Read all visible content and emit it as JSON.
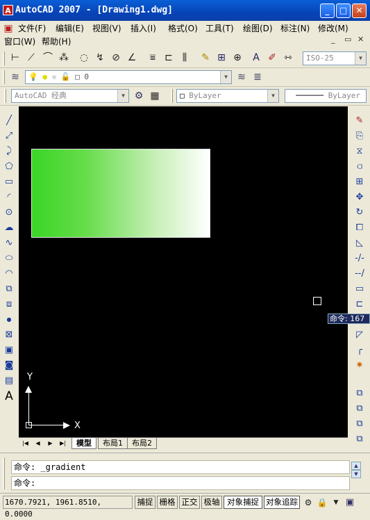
{
  "window": {
    "title": "AutoCAD 2007 - [Drawing1.dwg]",
    "app_icon_glyph": "A",
    "minimize_glyph": "_",
    "maximize_glyph": "□",
    "close_glyph": "✕"
  },
  "menu": {
    "items": [
      "文件(F)",
      "编辑(E)",
      "视图(V)",
      "插入(I)",
      "格式(O)",
      "工具(T)",
      "绘图(D)",
      "标注(N)",
      "修改(M)"
    ],
    "items2": [
      "窗口(W)",
      "帮助(H)"
    ],
    "mdi_buttons": [
      "_",
      "▭",
      "✕"
    ]
  },
  "toolbars": {
    "dimstyle_value": "ISO-25",
    "layer_value": "0",
    "workspace_value": "AutoCAD 经典",
    "color_value": "ByLayer",
    "linetype_value": "ByLayer"
  },
  "layout_tabs": {
    "nav": [
      "|◀",
      "◀",
      "▶",
      "▶|"
    ],
    "tabs": [
      "模型",
      "布局1",
      "布局2"
    ],
    "active_index": 0
  },
  "ucs": {
    "x_label": "X",
    "y_label": "Y"
  },
  "tooltip": {
    "text": "命令: 167"
  },
  "command": {
    "history_line": "命令: _gradient",
    "prompt": "命令:"
  },
  "status": {
    "coordinates": "1670.7921, 1961.8510, 0.0000",
    "toggles": [
      {
        "label": "捕捉",
        "on": false
      },
      {
        "label": "栅格",
        "on": false
      },
      {
        "label": "正交",
        "on": false
      },
      {
        "label": "极轴",
        "on": false
      },
      {
        "label": "对象捕捉",
        "on": true
      },
      {
        "label": "对象追踪",
        "on": true
      }
    ]
  },
  "colors": {
    "canvas_bg": "#000000",
    "gradient_start": "#3ad626",
    "gradient_end": "#ffffff",
    "titlebar": "#0a5fd6"
  }
}
